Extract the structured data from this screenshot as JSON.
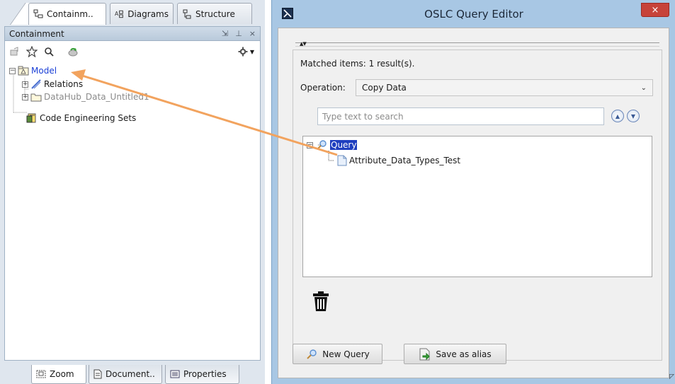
{
  "left_panel": {
    "top_tabs": [
      {
        "label": "Containm..",
        "icon": "containment-tree-icon",
        "active": true
      },
      {
        "label": "Diagrams",
        "icon": "diagrams-icon",
        "active": false
      },
      {
        "label": "Structure",
        "icon": "structure-icon",
        "active": false
      }
    ],
    "view_title": "Containment",
    "view_controls": [
      "⇲",
      "⊥",
      "×"
    ],
    "toolbar_icons": [
      "add-element-icon",
      "star-icon",
      "search-icon",
      "refresh-model-icon",
      "gear-icon"
    ],
    "tree": [
      {
        "label": "Model",
        "icon": "package-icon",
        "expander": "−",
        "level": 0
      },
      {
        "label": "Relations",
        "icon": "relations-icon",
        "expander": "+",
        "level": 1
      },
      {
        "label": "DataHub_Data_Untitled1",
        "icon": "folder-icon",
        "expander": "+",
        "level": 1
      },
      {
        "label": "Code Engineering Sets",
        "icon": "code-sets-icon",
        "expander": "",
        "level": 0
      }
    ],
    "bottom_tabs": [
      {
        "label": "Zoom",
        "icon": "zoom-icon",
        "active": true
      },
      {
        "label": "Document..",
        "icon": "document-icon",
        "active": false
      },
      {
        "label": "Properties",
        "icon": "properties-icon",
        "active": false
      }
    ]
  },
  "dialog": {
    "title": "OSLC Query Editor",
    "close_label": "×",
    "matched_items": "Matched items: 1 result(s).",
    "operation_label": "Operation:",
    "operation_value": "Copy Data",
    "search_placeholder": "Type text to search",
    "result_tree": [
      {
        "label": "Query",
        "icon": "query-search-icon",
        "selected": true
      },
      {
        "label": "Attribute_Data_Types_Test",
        "icon": "document-file-icon",
        "selected": false
      }
    ],
    "buttons": {
      "new_query": "New Query",
      "save_alias": "Save as alias"
    }
  },
  "colors": {
    "annotation_arrow": "#f2a35e",
    "selection": "#1f3fbf",
    "dialog_frame": "#a8c7e4",
    "close_button": "#c7433a"
  }
}
